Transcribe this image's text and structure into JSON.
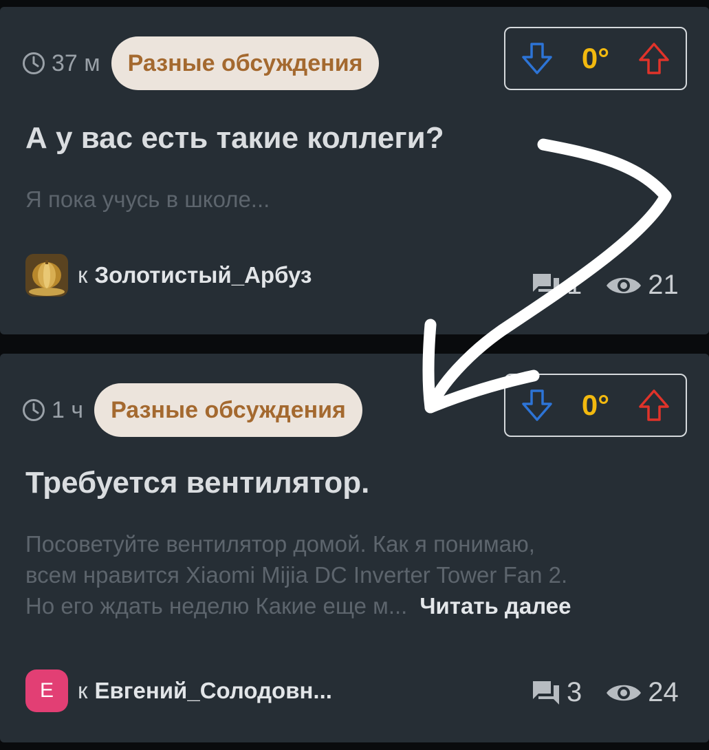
{
  "posts": [
    {
      "time": "37 м",
      "category": "Разные обсуждения",
      "rating": "0°",
      "title": "А у вас есть такие коллеги?",
      "excerpt_lines": [
        "Я пока учусь в школе..."
      ],
      "read_more": "",
      "author_prefix": "к",
      "author": "Золотистый_Арбуз",
      "avatar": "golden-pumpkin-image",
      "comments": "1",
      "views": "21"
    },
    {
      "time": "1 ч",
      "category": "Разные обсуждения",
      "rating": "0°",
      "title": "Требуется вентилятор.",
      "excerpt_lines": [
        "Посоветуйте вентилятор домой. Как я понимаю,",
        "всем нравится Xiaomi Mijia DC Inverter Tower Fan 2.",
        "Но его ждать неделю  Какие еще м..."
      ],
      "read_more": "Читать далее",
      "author_prefix": "к",
      "author": "Евгений_Солодовн...",
      "avatar_letter": "Е",
      "avatar_color": "#e23f74",
      "comments": "3",
      "views": "24"
    }
  ],
  "icons": {
    "time": "clock-icon",
    "downvote": "arrow-down-icon",
    "upvote": "arrow-up-icon",
    "comments": "comments-icon",
    "views": "eye-icon"
  },
  "colors": {
    "card_bg": "#262e35",
    "category_bg": "#ece4dc",
    "category_text": "#a4692f",
    "rating": "#f2b90f",
    "downvote": "#2d74d6",
    "upvote": "#e0332a"
  }
}
